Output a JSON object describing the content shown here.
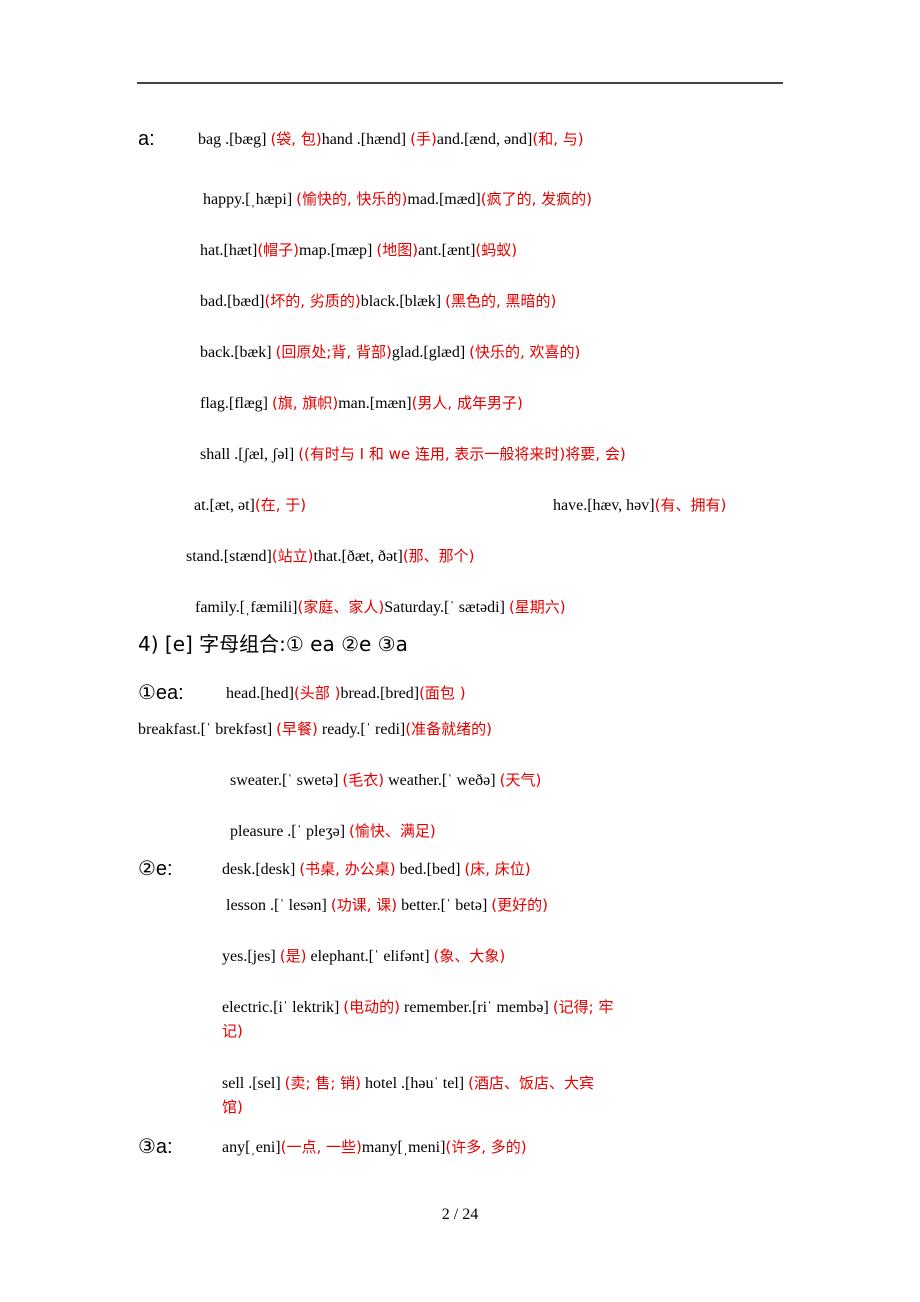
{
  "section_a": {
    "label": "a:",
    "lines": [
      [
        [
          "en",
          "bag .[bæg] "
        ],
        [
          "zh",
          "(袋, 包)"
        ],
        [
          "en",
          "hand .[hænd] "
        ],
        [
          "zh",
          "(手)"
        ],
        [
          "en",
          "and.[ænd, ənd]"
        ],
        [
          "zh",
          "(和, 与)"
        ]
      ],
      [
        [
          "en",
          "happy.[ˌhæpi] "
        ],
        [
          "zh",
          "(愉快的, 快乐的)"
        ],
        [
          "en",
          "mad.[mæd]"
        ],
        [
          "zh",
          "(疯了的, 发疯的)"
        ]
      ],
      [
        [
          "en",
          "hat.[hæt]"
        ],
        [
          "zh",
          "(帽子)"
        ],
        [
          "en",
          "map.[mæp] "
        ],
        [
          "zh",
          "(地图)"
        ],
        [
          "en",
          "ant.[ænt]"
        ],
        [
          "zh",
          "(蚂蚁)"
        ]
      ],
      [
        [
          "en",
          "bad.[bæd]"
        ],
        [
          "zh",
          "(坏的, 劣质的)"
        ],
        [
          "en",
          "black.[blæk] "
        ],
        [
          "zh",
          "(黑色的, 黑暗的)"
        ]
      ],
      [
        [
          "en",
          "back.[bæk] "
        ],
        [
          "zh",
          "(回原处;背, 背部)"
        ],
        [
          "en",
          "glad.[glæd] "
        ],
        [
          "zh",
          "(快乐的, 欢喜的)"
        ]
      ],
      [
        [
          "en",
          "flag.[flæg] "
        ],
        [
          "zh",
          "(旗, 旗帜)"
        ],
        [
          "en",
          "man.[mæn]"
        ],
        [
          "zh",
          "(男人, 成年男子)"
        ]
      ],
      [
        [
          "en",
          "shall .[ʃæl, ʃəl] "
        ],
        [
          "zh",
          "((有时与 I 和 we 连用, 表示一般将来时)将要, 会)"
        ]
      ]
    ],
    "at_line": [
      [
        "en",
        "at.[æt, ət]"
      ],
      [
        "zh",
        "(在, 于)"
      ]
    ],
    "have_line": [
      [
        "en",
        "have.[hæv, həv]"
      ],
      [
        "zh",
        "(有、拥有)"
      ]
    ],
    "stand_line": [
      [
        "en",
        "stand.[stænd]"
      ],
      [
        "zh",
        "(站立)"
      ],
      [
        "en",
        "that.[ðæt, ðət]"
      ],
      [
        "zh",
        "(那、那个)"
      ]
    ],
    "family_line": [
      [
        "en",
        "family.[ˌfæmili]"
      ],
      [
        "zh",
        "(家庭、家人)"
      ],
      [
        "en",
        "Saturday.[ˈ sætədi] "
      ],
      [
        "zh",
        "(星期六)"
      ]
    ]
  },
  "section4": {
    "heading": "4) [e] 字母组合:① ea ②e ③a"
  },
  "sub_ea": {
    "label": "①ea:",
    "lines": [
      [
        [
          "en",
          "head.[hed]"
        ],
        [
          "zh",
          "(头部 )"
        ],
        [
          "en",
          "bread.[bred]"
        ],
        [
          "zh",
          "(面包 )"
        ]
      ],
      [
        [
          "en",
          "breakfast.[ˈ brekfəst] "
        ],
        [
          "zh",
          "(早餐)"
        ],
        [
          "en",
          " ready.[ˈ redi]"
        ],
        [
          "zh",
          "(准备就绪的)"
        ]
      ],
      [
        [
          "en",
          "sweater.[ˈ swetə] "
        ],
        [
          "zh",
          "(毛衣)"
        ],
        [
          "en",
          " weather.[ˈ weðə] "
        ],
        [
          "zh",
          "(天气)"
        ]
      ],
      [
        [
          "en",
          "pleasure .[ˈ pleʒə] "
        ],
        [
          "zh",
          "(愉快、满足)"
        ]
      ]
    ]
  },
  "sub_e": {
    "label": "②e:",
    "lines": [
      [
        [
          "en",
          "desk.[desk] "
        ],
        [
          "zh",
          "(书桌, 办公桌)"
        ],
        [
          "en",
          " bed.[bed] "
        ],
        [
          "zh",
          "(床, 床位)"
        ]
      ],
      [
        [
          "en",
          "lesson .[ˈ lesən] "
        ],
        [
          "zh",
          "(功课, 课)"
        ],
        [
          "en",
          " better.[ˈ betə] "
        ],
        [
          "zh",
          "(更好的)"
        ]
      ],
      [
        [
          "en",
          "yes.[jes]  "
        ],
        [
          "zh",
          "(是)"
        ],
        [
          "en",
          " elephant.[ˈ elifənt] "
        ],
        [
          "zh",
          "(象、大象)"
        ]
      ],
      [
        [
          "en",
          "electric.[iˈ lektrik] "
        ],
        [
          "zh",
          "(电动的)"
        ],
        [
          "en",
          "  remember.[riˈ membə] "
        ],
        [
          "zh",
          "(记得; 牢"
        ]
      ],
      [
        [
          "zh",
          "记)"
        ]
      ],
      [
        [
          "en",
          "sell .[sel]  "
        ],
        [
          "zh",
          "(卖; 售; 销)"
        ],
        [
          "en",
          " hotel .[həuˈ tel] "
        ],
        [
          "zh",
          "(酒店、饭店、大宾"
        ]
      ],
      [
        [
          "zh",
          "馆)"
        ]
      ]
    ]
  },
  "sub_a": {
    "label": "③a:",
    "lines": [
      [
        [
          "en",
          "any[ˌeni]"
        ],
        [
          "zh",
          "(一点, 一些)"
        ],
        [
          "en",
          "many[ˌmeni]"
        ],
        [
          "zh",
          "(许多, 多的)"
        ]
      ]
    ]
  },
  "footer": {
    "page_current": "2",
    "page_total": "24",
    "page_text": "2 / 24"
  }
}
